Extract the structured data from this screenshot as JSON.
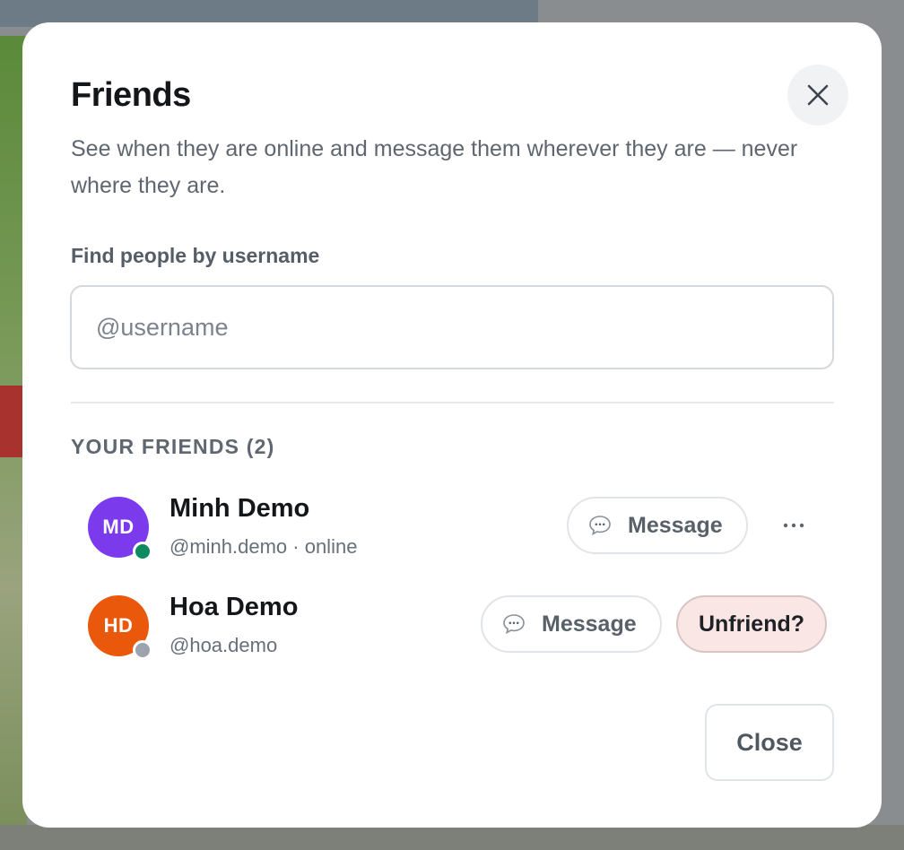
{
  "dialog": {
    "title": "Friends",
    "subtitle": "See when they are online and message them wherever they are — never where they are.",
    "close_icon": "close-icon"
  },
  "search": {
    "label": "Find people by username",
    "placeholder": "@username",
    "value": ""
  },
  "friends_section": {
    "label": "YOUR FRIENDS (2)"
  },
  "friends": [
    {
      "initials": "MD",
      "name": "Minh Demo",
      "subline": "@minh.demo · online",
      "avatar_color": "#7c3aed",
      "status": "online",
      "status_color": "#0e8a5f",
      "message_label": "Message",
      "message_icon": "chat-bubble-icon",
      "more_icon": "more-horizontal-icon"
    },
    {
      "initials": "HD",
      "name": "Hoa Demo",
      "subline": "@hoa.demo",
      "avatar_color": "#ea580c",
      "status": "offline",
      "status_color": "#9ca3af",
      "message_label": "Message",
      "message_icon": "chat-bubble-icon",
      "unfriend_label": "Unfriend?"
    }
  ],
  "footer": {
    "close_label": "Close"
  }
}
